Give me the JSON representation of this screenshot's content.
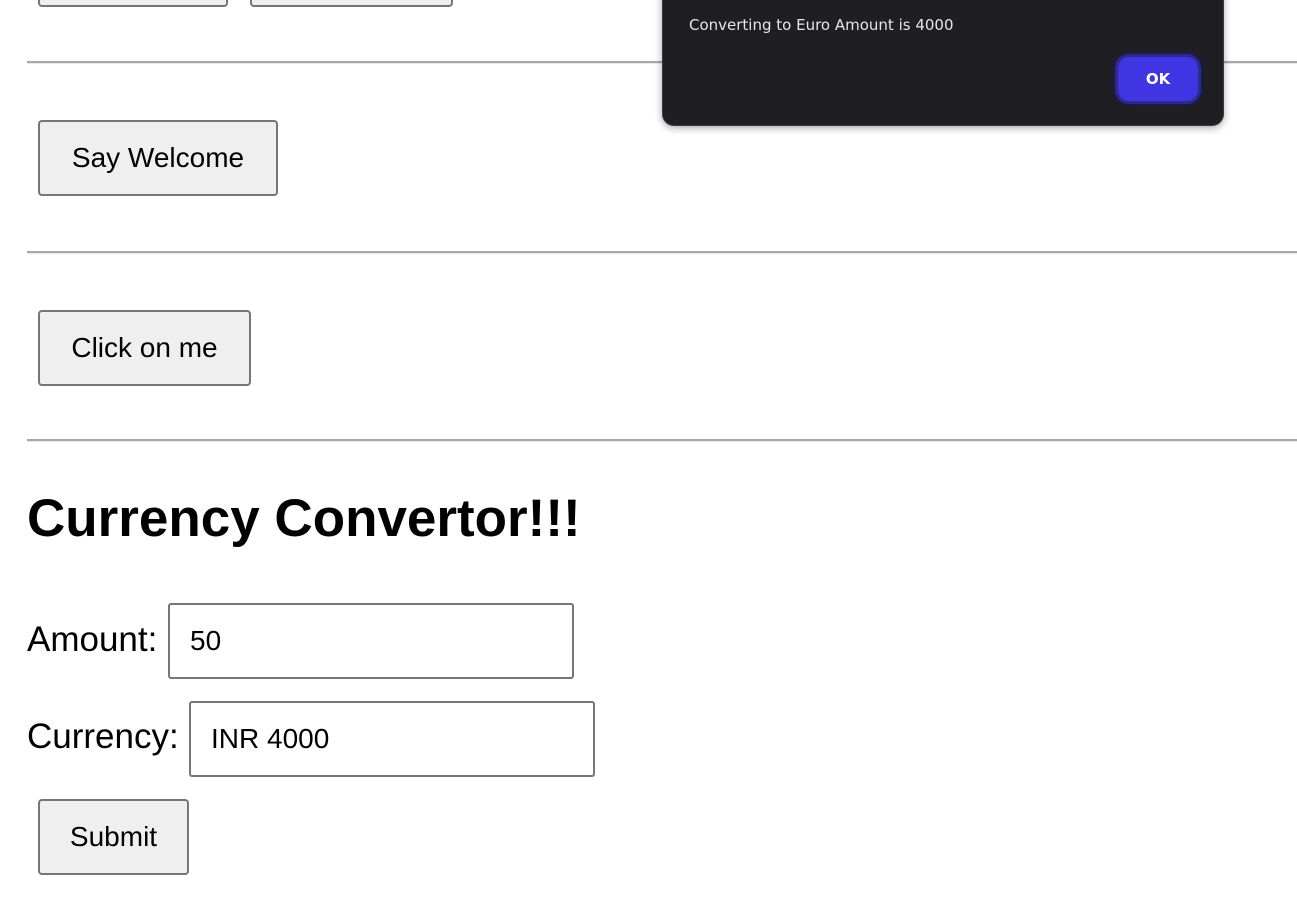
{
  "top_buttons": {
    "first_label": "",
    "second_label": ""
  },
  "welcome_section": {
    "button_label": "Say Welcome"
  },
  "click_section": {
    "button_label": "Click on me"
  },
  "converter": {
    "title": "Currency Convertor!!!",
    "amount_label": "Amount:",
    "amount_value": "50",
    "currency_label": "Currency:",
    "currency_value": "INR 4000",
    "submit_label": "Submit"
  },
  "alert_dialog": {
    "message": "Converting to Euro Amount is 4000",
    "ok_label": "OK"
  },
  "colors": {
    "dialog_bg": "#1f1f23",
    "ok_button": "#3f35e3",
    "button_bg": "#efefef"
  }
}
